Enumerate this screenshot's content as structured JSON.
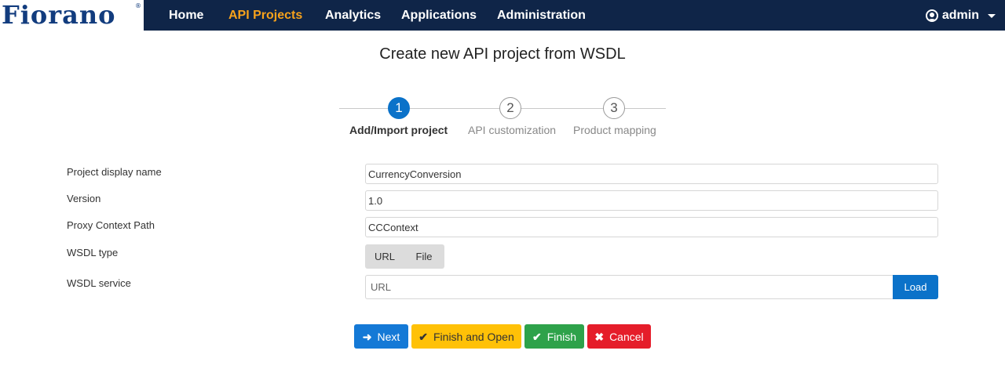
{
  "brand": {
    "logo_text": "Fiorano",
    "registered_mark": "®",
    "colors": {
      "navbar_bg": "#0f2548",
      "active_nav": "#f7a21b",
      "primary": "#0b72c9"
    }
  },
  "nav": {
    "items": [
      {
        "label": "Home"
      },
      {
        "label": "API Projects",
        "active": true
      },
      {
        "label": "Analytics"
      },
      {
        "label": "Applications"
      },
      {
        "label": "Administration"
      }
    ],
    "user": {
      "icon": "user-circle-icon",
      "label": "admin"
    }
  },
  "page": {
    "title": "Create new API project from WSDL"
  },
  "stepper": {
    "steps": [
      {
        "number": "1",
        "label": "Add/Import project",
        "active": true
      },
      {
        "number": "2",
        "label": "API customization"
      },
      {
        "number": "3",
        "label": "Product mapping"
      }
    ]
  },
  "form": {
    "project_display_name": {
      "label": "Project display name",
      "value": "CurrencyConversion"
    },
    "version": {
      "label": "Version",
      "value": "1.0"
    },
    "proxy_context_path": {
      "label": "Proxy Context Path",
      "value": "CCContext"
    },
    "wsdl_type": {
      "label": "WSDL type",
      "options": [
        "URL",
        "File"
      ]
    },
    "wsdl_service": {
      "label": "WSDL service",
      "placeholder": "URL",
      "button_label": "Load"
    }
  },
  "actions": {
    "next": {
      "label": "Next",
      "icon": "arrow-right-icon"
    },
    "finish_and_open": {
      "label": "Finish and Open",
      "icon": "check-icon"
    },
    "finish": {
      "label": "Finish",
      "icon": "check-icon"
    },
    "cancel": {
      "label": "Cancel",
      "icon": "close-icon"
    }
  }
}
